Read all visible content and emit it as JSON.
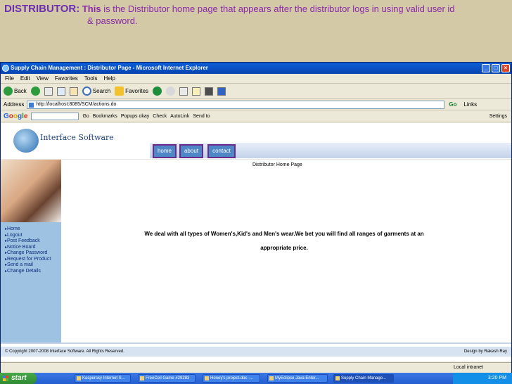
{
  "caption": {
    "lead": "DISTRIBUTOR:",
    "this": "This",
    "line1": " is the  Distributor home page that appears after the distributor logs in using valid user id",
    "line2": "& password."
  },
  "window": {
    "title": "Supply Chain Management : Distributor Page - Microsoft Internet Explorer",
    "menu": [
      "File",
      "Edit",
      "View",
      "Favorites",
      "Tools",
      "Help"
    ],
    "toolbar": {
      "back": "Back",
      "search": "Search",
      "favorites": "Favorites"
    },
    "address_label": "Address",
    "address_value": "http://localhost:8085/SCM/actions.do",
    "go_label": "Go",
    "links_label": "Links",
    "googlebar": {
      "go": "Go",
      "bookmarks": "Bookmarks",
      "popups": "Popups okay",
      "check": "Check",
      "autolink": "AutoLink",
      "sendto": "Send to",
      "settings": "Settings"
    },
    "status_zone": "Local intranet"
  },
  "page": {
    "logo_text": "Interface Software",
    "nav": [
      "home",
      "about",
      "contact"
    ],
    "title": "Distributor Home Page",
    "sidebar": [
      "Home",
      "Logout",
      "Post Feedback",
      "Notice Board",
      "Change Password",
      "Request for Product",
      "Send a mail",
      "Change Details"
    ],
    "body_line1": "We deal with all types of Women's,Kid's and Men's wear.We bet you will find all ranges of garments at an",
    "body_line2": "appropriate price.",
    "footer_left": "© Copyright 2007-2008 Interface Software. All Rights Reserved.",
    "footer_right": "Design by Rakesh Ray"
  },
  "taskbar": {
    "start": "start",
    "tasks": [
      "Kaspersky Internet S...",
      "FreeCell Game #29283",
      "Honey's project.doc -...",
      "MyEclipse Java Enter...",
      "Supply Chain Manage..."
    ],
    "clock": "3:20 PM"
  }
}
